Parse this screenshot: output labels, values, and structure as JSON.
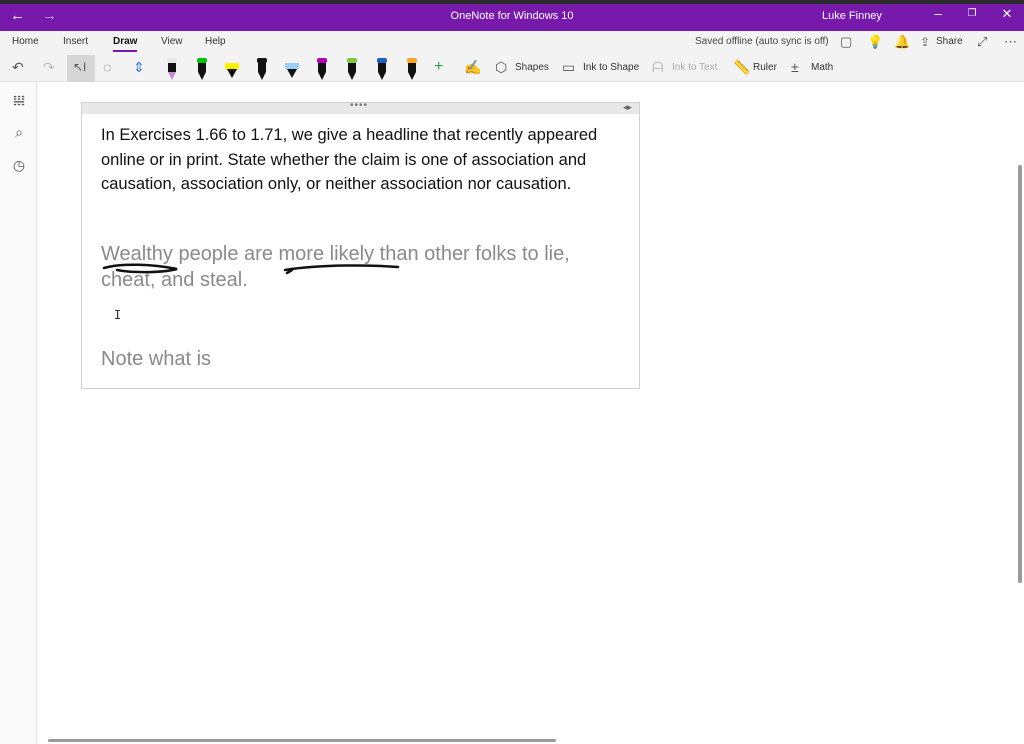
{
  "window": {
    "title": "OneNote for Windows 10",
    "user": "Luke Finney",
    "back_glyph": "←",
    "forward_glyph": "→",
    "minimize_glyph": "–",
    "restore_glyph": "❐",
    "close_glyph": "✕"
  },
  "ribbon": {
    "tabs": [
      "Home",
      "Insert",
      "Draw",
      "View",
      "Help"
    ],
    "active_tab": "Draw",
    "status": "Saved offline (auto sync is off)",
    "share_label": "Share",
    "more_glyph": "⋯"
  },
  "toolbar": {
    "pens": [
      {
        "type": "pen",
        "cap": "#e8e8e8",
        "color": "#c58ad8"
      },
      {
        "type": "pen",
        "cap": "#00c000",
        "color": "#111111"
      },
      {
        "type": "highlighter",
        "cap": "#ffee00",
        "color": "#ffee00"
      },
      {
        "type": "pen",
        "cap": "#111111",
        "color": "#111111"
      },
      {
        "type": "highlighter",
        "cap": "#9ad0f5",
        "color": "#9ad0f5"
      },
      {
        "type": "pen",
        "cap": "#b000b0",
        "color": "#111111"
      },
      {
        "type": "pen",
        "cap": "#7ac943",
        "color": "#111111"
      },
      {
        "type": "pen",
        "cap": "#1f5fbf",
        "color": "#111111"
      },
      {
        "type": "pen",
        "cap": "#f5a623",
        "color": "#111111"
      }
    ],
    "add_pen_glyph": "+",
    "shapes_label": "Shapes",
    "ink_to_shape_label": "Ink to Shape",
    "ink_to_text_label": "Ink to Text",
    "ruler_label": "Ruler",
    "math_label": "Math"
  },
  "page": {
    "instructions": "In Exercises 1.66 to 1.71, we give a headline that recently appeared online or in print. State whether the claim is one of association and causation, association only, or neither association nor causation.",
    "headline_line1": "Wealthy people are more likely than other folks to lie,",
    "headline_line2": "cheat, and steal.",
    "note": "Note what is",
    "cursor_glyph": "I"
  },
  "colors": {
    "accent": "#7719aa",
    "ink": "#111111"
  }
}
